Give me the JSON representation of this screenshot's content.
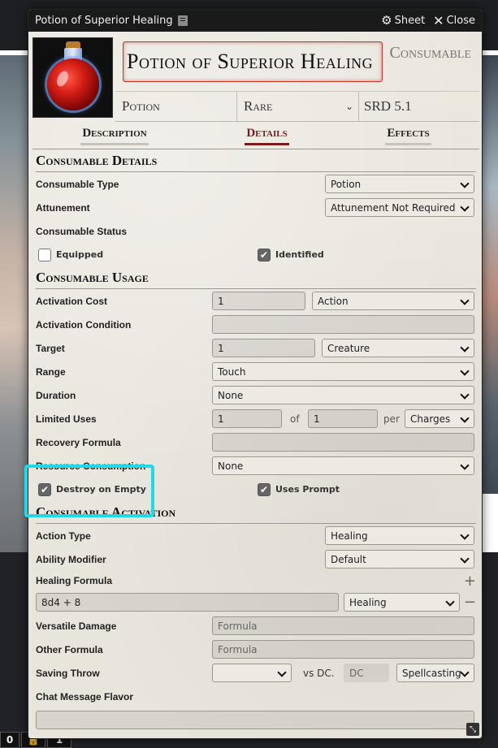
{
  "window": {
    "title": "Potion of Superior Healing",
    "sheet_label": "Sheet",
    "close_label": "Close"
  },
  "header": {
    "name": "Potion of Superior Healing",
    "item_type": "Consumable",
    "type_label": "Potion",
    "rarity": "Rare",
    "source": "SRD 5.1"
  },
  "tabs": [
    {
      "label": "Description",
      "active": false
    },
    {
      "label": "Details",
      "active": true
    },
    {
      "label": "Effects",
      "active": false
    }
  ],
  "details": {
    "title": "Consumable Details",
    "consumable_type": {
      "label": "Consumable Type",
      "value": "Potion"
    },
    "attunement": {
      "label": "Attunement",
      "value": "Attunement Not Required"
    },
    "status": {
      "label": "Consumable Status"
    },
    "equipped": {
      "label": "Equipped",
      "checked": false
    },
    "identified": {
      "label": "Identified",
      "checked": true
    }
  },
  "usage": {
    "title": "Consumable Usage",
    "activation_cost": {
      "label": "Activation Cost",
      "value": "1",
      "unit": "Action"
    },
    "activation_condition": {
      "label": "Activation Condition",
      "value": ""
    },
    "target": {
      "label": "Target",
      "value": "1",
      "type": "Creature"
    },
    "range": {
      "label": "Range",
      "value": "Touch"
    },
    "duration": {
      "label": "Duration",
      "value": "None"
    },
    "limited_uses": {
      "label": "Limited Uses",
      "value": "1",
      "of_label": "of",
      "max": "1",
      "per_label": "per",
      "per": "Charges"
    },
    "recovery_formula": {
      "label": "Recovery Formula",
      "value": ""
    },
    "resource_consumption": {
      "label": "Resource Consumption",
      "value": "None"
    },
    "destroy_on_empty": {
      "label": "Destroy on Empty",
      "checked": true
    },
    "uses_prompt": {
      "label": "Uses Prompt",
      "checked": true
    }
  },
  "activation": {
    "title": "Consumable Activation",
    "action_type": {
      "label": "Action Type",
      "value": "Healing"
    },
    "ability_modifier": {
      "label": "Ability Modifier",
      "value": "Default"
    },
    "healing_formula": {
      "label": "Healing Formula",
      "value": "8d4 + 8",
      "type": "Healing",
      "add": "+",
      "remove": "−"
    },
    "versatile_damage": {
      "label": "Versatile Damage",
      "placeholder": "Formula"
    },
    "other_formula": {
      "label": "Other Formula",
      "placeholder": "Formula"
    },
    "saving_throw": {
      "label": "Saving Throw",
      "value": "",
      "vs_label": "vs DC.",
      "dc_placeholder": "DC",
      "scaling": "Spellcasting"
    },
    "chat_flavor": {
      "label": "Chat Message Flavor",
      "value": ""
    }
  },
  "hotbar": {
    "page": "0",
    "slot": "1"
  },
  "annotation_color": "#1fd8e8",
  "accent_color": "#7a1b1b"
}
